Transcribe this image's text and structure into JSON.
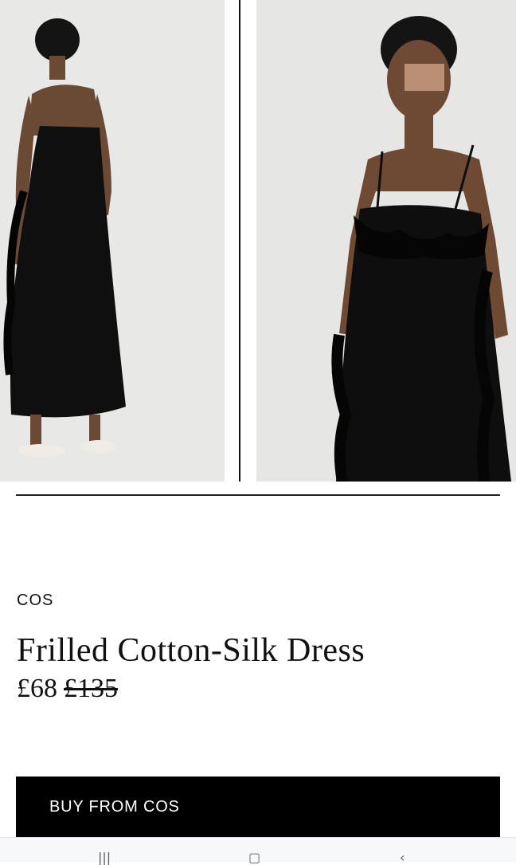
{
  "gallery": {
    "images": [
      {
        "name": "dress-back-view"
      },
      {
        "name": "dress-front-view"
      }
    ]
  },
  "product": {
    "brand": "COS",
    "title": "Frilled Cotton-Silk Dress",
    "price": "£68",
    "original_price": "£135"
  },
  "actions": {
    "buy_label": "BUY FROM COS"
  },
  "navbar": {
    "icons": [
      "recents-icon",
      "home-icon",
      "back-icon"
    ]
  },
  "colors": {
    "button_bg": "#000000",
    "button_text": "#ffffff",
    "photo_bg": "#e6e6e4",
    "dress": "#0e0e0e"
  }
}
